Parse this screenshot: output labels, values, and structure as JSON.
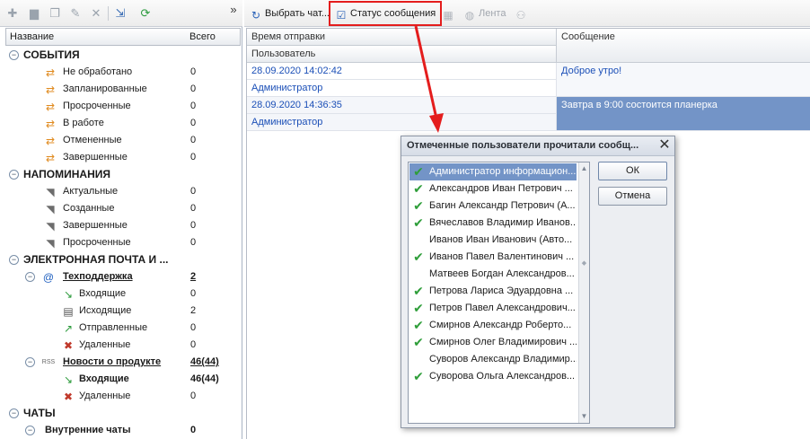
{
  "left_toolbar": {
    "icons": [
      "new-icon",
      "folder-icon",
      "copy-icon",
      "edit-icon",
      "delete-icon",
      "move-icon",
      "refresh-icon"
    ],
    "more": "»"
  },
  "tree": {
    "col_name": "Название",
    "col_total": "Всего",
    "groups": [
      {
        "label": "СОБЫТИЯ",
        "expand": "⊖",
        "items": [
          {
            "label": "Не обработано",
            "count": "0"
          },
          {
            "label": "Запланированные",
            "count": "0"
          },
          {
            "label": "Просроченные",
            "count": "0"
          },
          {
            "label": "В работе",
            "count": "0"
          },
          {
            "label": "Отмененные",
            "count": "0"
          },
          {
            "label": "Завершенные",
            "count": "0"
          }
        ]
      },
      {
        "label": "НАПОМИНАНИЯ",
        "expand": "⊖",
        "items": [
          {
            "label": "Актуальные",
            "count": "0"
          },
          {
            "label": "Созданные",
            "count": "0"
          },
          {
            "label": "Завершенные",
            "count": "0"
          },
          {
            "label": "Просроченные",
            "count": "0"
          }
        ]
      },
      {
        "label": "ЭЛЕКТРОННАЯ ПОЧТА И ...",
        "expand": "⊖",
        "accounts": [
          {
            "label": "Техподдержка",
            "count": "2",
            "expand": "⊖",
            "items": [
              {
                "label": "Входящие",
                "count": "0"
              },
              {
                "label": "Исходящие",
                "count": "2"
              },
              {
                "label": "Отправленные",
                "count": "0"
              },
              {
                "label": "Удаленные",
                "count": "0"
              }
            ]
          },
          {
            "label": "Новости о продукте",
            "count": "46(44)",
            "expand": "⊖",
            "rss": "RSS",
            "items": [
              {
                "label": "Входящие",
                "count": "46(44)"
              },
              {
                "label": "Удаленные",
                "count": "0"
              }
            ]
          }
        ]
      },
      {
        "label": "ЧАТЫ",
        "expand": "⊖",
        "items": [
          {
            "label": "Внутренние чаты",
            "count": "0"
          }
        ]
      }
    ]
  },
  "right_toolbar": {
    "choose_chat": "Выбрать чат...",
    "message_status": "Статус сообщения",
    "feed": "Лента"
  },
  "grid": {
    "col_time": "Время отправки",
    "col_user": "Пользователь",
    "col_message": "Сообщение",
    "rows": [
      {
        "time": "28.09.2020 14:02:42",
        "user": "Администратор",
        "message": "Доброе утро!"
      },
      {
        "time": "28.09.2020 14:36:35",
        "user": "Администратор",
        "message": "Завтра в 9:00 состоится планерка"
      }
    ]
  },
  "dialog": {
    "title": "Отмеченные пользователи прочитали сообщ...",
    "close": "✕",
    "ok": "ОК",
    "cancel": "Отмена",
    "users": [
      {
        "name": "Администратор информацион...",
        "read": true
      },
      {
        "name": "Александров Иван Петрович ...",
        "read": true
      },
      {
        "name": "Багин Александр Петрович (А...",
        "read": true
      },
      {
        "name": "Вячеславов Владимир Иванов...",
        "read": true
      },
      {
        "name": "Иванов Иван Иванович (Авто...",
        "read": false
      },
      {
        "name": "Иванов Павел Валентинович ...",
        "read": true
      },
      {
        "name": "Матвеев Богдан Александров...",
        "read": false
      },
      {
        "name": "Петрова Лариса Эдуардовна ...",
        "read": true
      },
      {
        "name": "Петров Павел Александрович...",
        "read": true
      },
      {
        "name": "Смирнов Александр Роберто...",
        "read": true
      },
      {
        "name": "Смирнов Олег Владимирович ...",
        "read": true
      },
      {
        "name": "Суворов Александр Владимир...",
        "read": false
      },
      {
        "name": "Суворова Ольга Александров...",
        "read": true
      }
    ]
  },
  "colors": {
    "highlight": "#e41d1d",
    "selection": "#7394c7",
    "link": "#1b4fb7",
    "check": "#2f9e3a"
  }
}
